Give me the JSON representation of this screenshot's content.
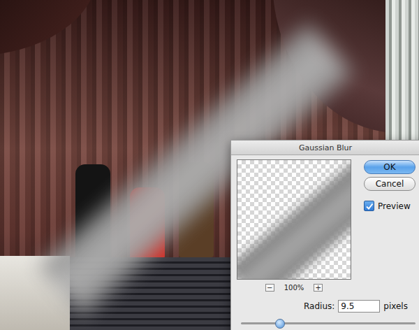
{
  "dialog": {
    "title": "Gaussian Blur",
    "buttons": [
      {
        "label": "OK",
        "default": true
      },
      {
        "label": "Cancel",
        "default": false
      }
    ],
    "preview": {
      "label": "Preview",
      "checked": true
    },
    "zoom": {
      "out": "−",
      "level": "100%",
      "in": "+"
    },
    "radius": {
      "label": "Radius:",
      "value": "9.5",
      "unit": "pixels",
      "level": 0.22
    }
  }
}
